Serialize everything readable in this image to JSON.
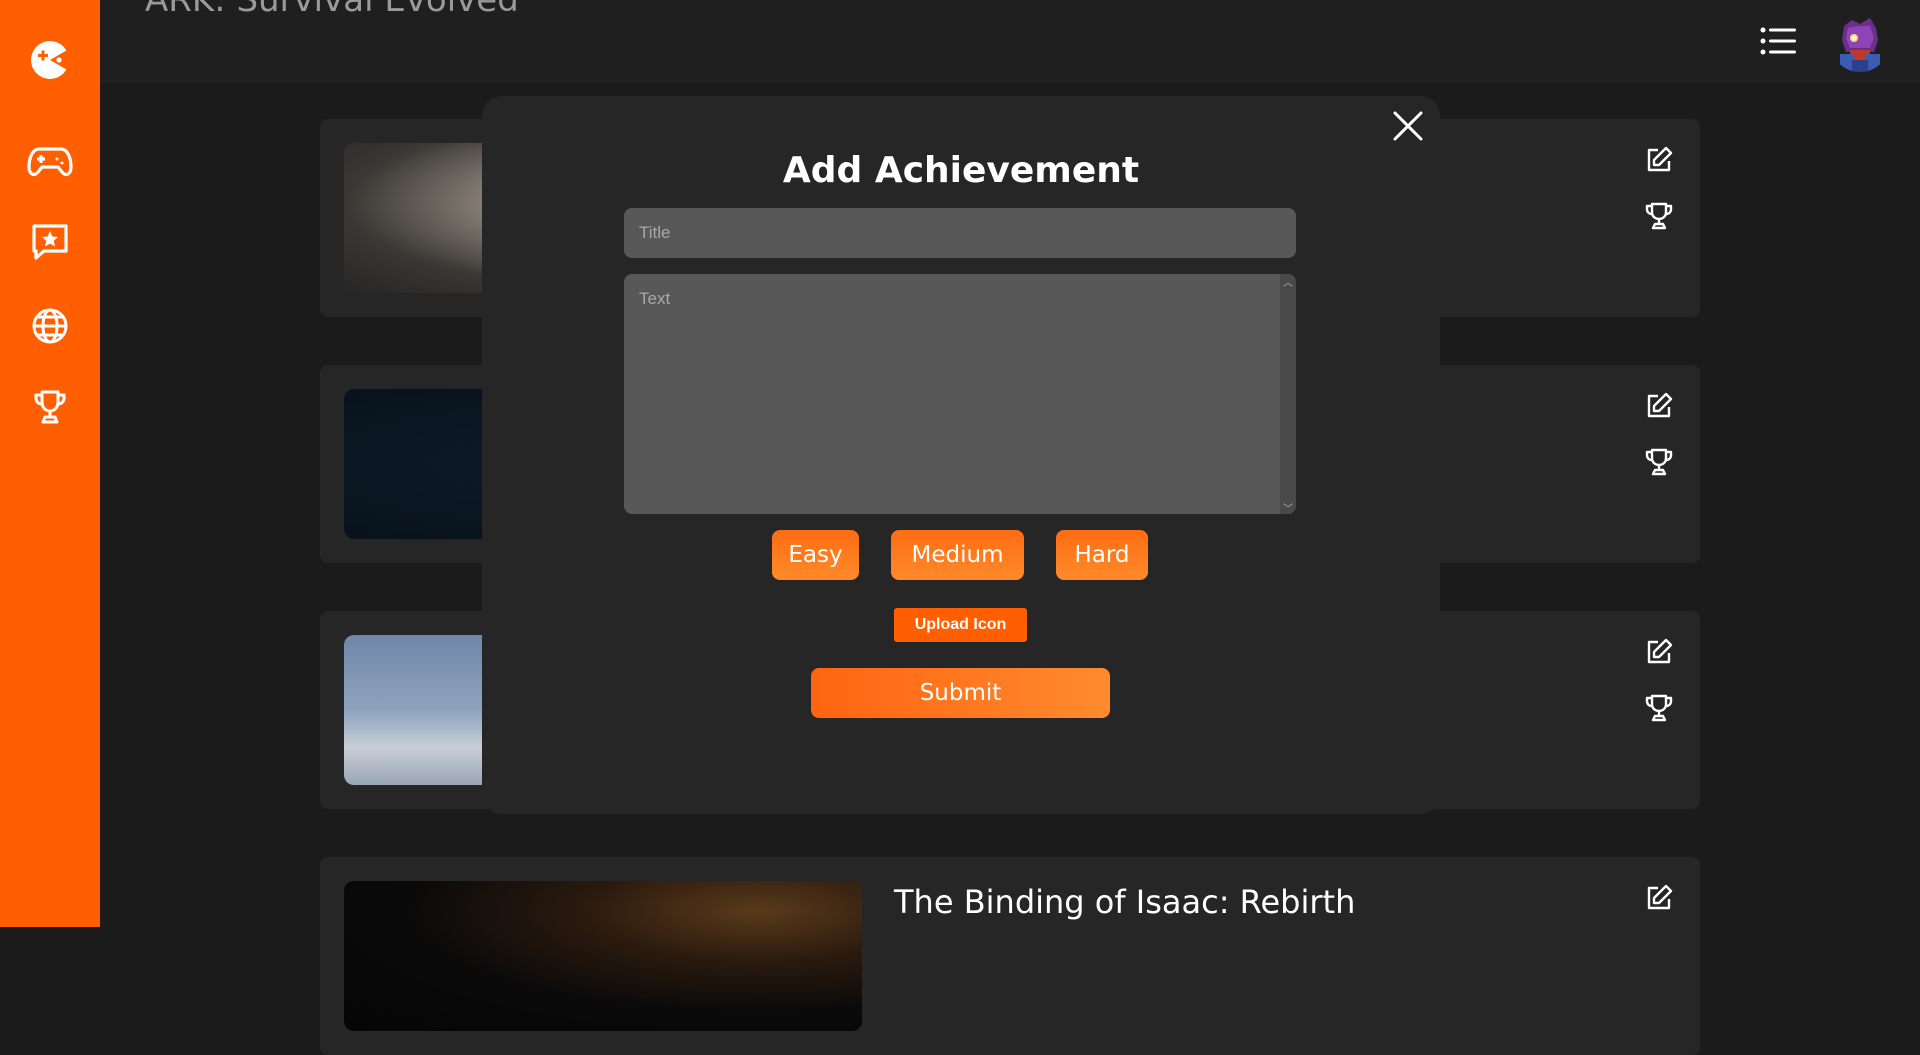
{
  "colors": {
    "accent": "#ff5f00",
    "background": "#1b1b1b",
    "card": "#262626",
    "input": "#585858"
  },
  "header": {
    "page_title": "ARK: Survival Evolved",
    "menu_icon": "list-icon",
    "avatar_icon": "user-avatar"
  },
  "sidebar": {
    "items": [
      {
        "icon": "logo-icon"
      },
      {
        "icon": "gamepad-icon"
      },
      {
        "icon": "star-message-icon"
      },
      {
        "icon": "globe-icon"
      },
      {
        "icon": "trophy-icon"
      }
    ]
  },
  "cards": [
    {
      "title": "",
      "edit_icon": "edit-icon",
      "trophy_icon": "trophy-icon"
    },
    {
      "title": "",
      "edit_icon": "edit-icon",
      "trophy_icon": "trophy-icon"
    },
    {
      "title": "",
      "edit_icon": "edit-icon",
      "trophy_icon": "trophy-icon"
    },
    {
      "title": "The Binding of Isaac: Rebirth",
      "edit_icon": "edit-icon"
    }
  ],
  "modal": {
    "title": "Add Achievement",
    "title_placeholder": "Title",
    "title_value": "",
    "text_placeholder": "Text",
    "text_value": "",
    "difficulty": {
      "easy": "Easy",
      "medium": "Medium",
      "hard": "Hard"
    },
    "upload_label": "Upload Icon",
    "submit_label": "Submit",
    "close_icon": "close-icon"
  }
}
